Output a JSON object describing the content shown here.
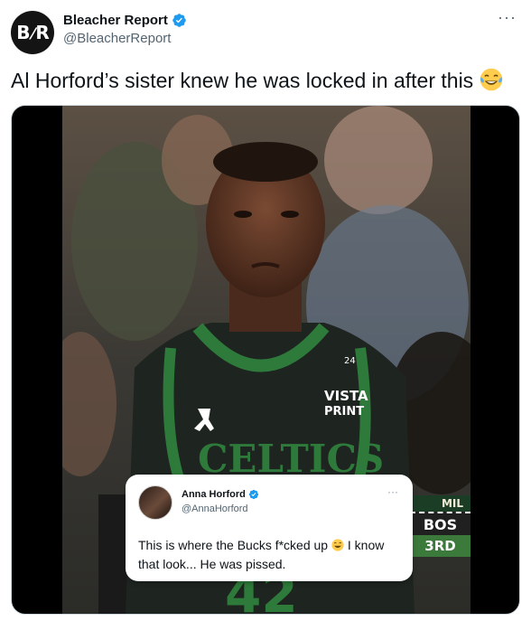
{
  "account": {
    "display_name": "Bleacher Report",
    "handle": "@BleacherReport",
    "avatar_text": "B/R",
    "verified": true
  },
  "tweet": {
    "text": "Al Horford’s sister knew he was locked in after this",
    "emoji": "face-with-tears-of-joy",
    "more_label": "···"
  },
  "media": {
    "jersey_number": "24",
    "jersey_sponsor_line1": "VISTA",
    "jersey_sponsor_line2": "PRINT",
    "jersey_team": "CELTICS",
    "jersey_front_number": "42",
    "scorebug": {
      "away": "MIL",
      "home": "BOS",
      "quarter": "3RD"
    },
    "quote": {
      "name": "Anna Horford",
      "handle": "@AnnaHorford",
      "more_label": "···",
      "text_before": "This is where the Bucks f*cked up",
      "text_after": " I know that look... He was pissed."
    }
  },
  "colors": {
    "verified_blue": "#1d9bf0",
    "celtics_green": "#2e7a3a"
  }
}
